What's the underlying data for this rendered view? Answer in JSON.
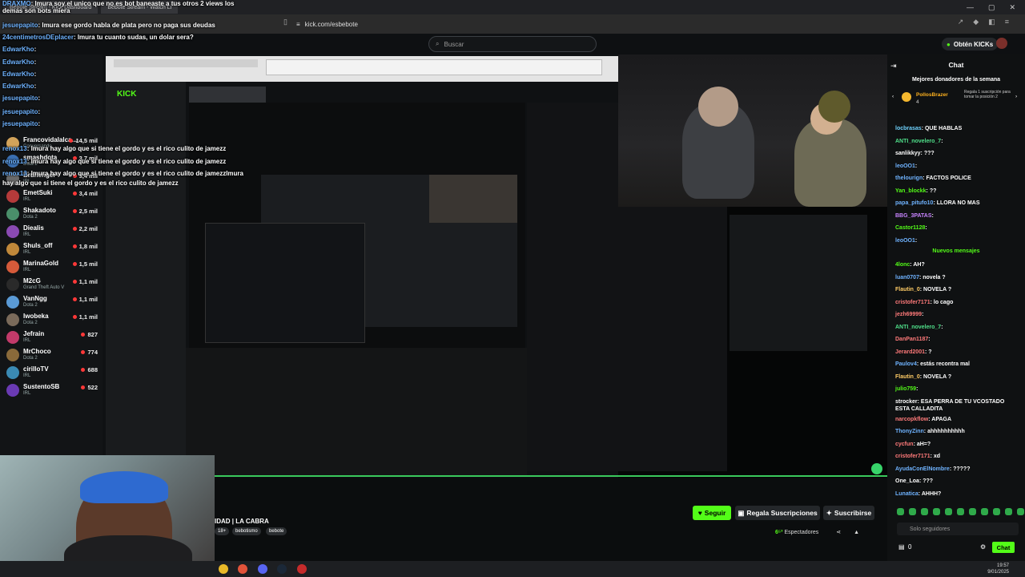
{
  "browser": {
    "tabs": [
      "Bebote Stream - Kick Dashboard",
      "Bebote Stream - Watch Li"
    ],
    "url": "kick.com/esbebote"
  },
  "header": {
    "search_placeholder": "Buscar",
    "kick_button": "Obtén KICKs"
  },
  "overlay_chat": [
    {
      "user": "DRAXMO",
      "text": "lmura soy el unico que no es bot baneaste a tus otros 2 views los demas son bots miera"
    },
    {
      "user": "jesuepapito",
      "text": "lmura ese gordo habla de plata pero no paga sus deudas"
    },
    {
      "user": "24centimetrosDEplacer",
      "text": "lmura tu cuanto sudas, un dolar sera?"
    },
    {
      "user": "EdwarKho",
      "text": ""
    },
    {
      "user": "EdwarKho",
      "text": ""
    },
    {
      "user": "EdwarKho",
      "text": ""
    },
    {
      "user": "EdwarKho",
      "text": ""
    },
    {
      "user": "jesuepapito",
      "text": ""
    },
    {
      "user": "jesuepapito",
      "text": ""
    },
    {
      "user": "jesuepapito",
      "text": ""
    },
    {
      "user": "renox13",
      "text": "lmura hay algo que si tiene el gordo y es el rico culito de jamezz"
    },
    {
      "user": "renox13",
      "text": "lmura hay algo que si tiene el gordo y es el rico culito de jamezz"
    },
    {
      "user": "renox13",
      "text": "lmura hay algo que si tiene el gordo y es el rico culito de jamezzlmura"
    },
    {
      "user": "",
      "text": "hay algo que si tiene el gordo y es el rico culito de jamezz"
    }
  ],
  "sidebar": {
    "channels": [
      {
        "name": "Francovidalalca...",
        "cat": "Conversando",
        "viewers": "14,5 mil"
      },
      {
        "name": "smashdota",
        "cat": "Dota 2",
        "viewers": "3,7 mil"
      },
      {
        "name": "Brunenger",
        "cat": "IRL",
        "viewers": "3,4 mil"
      },
      {
        "name": "EmetSuki",
        "cat": "IRL",
        "viewers": "3,4 mil"
      },
      {
        "name": "Shakadoto",
        "cat": "Dota 2",
        "viewers": "2,5 mil"
      },
      {
        "name": "Diealis",
        "cat": "IRL",
        "viewers": "2,2 mil"
      },
      {
        "name": "Shuls_off",
        "cat": "IRL",
        "viewers": "1,8 mil"
      },
      {
        "name": "MarinaGold",
        "cat": "IRL",
        "viewers": "1,5 mil"
      },
      {
        "name": "M2cG",
        "cat": "Grand Theft Auto V",
        "viewers": "1,1 mil"
      },
      {
        "name": "VanNgg",
        "cat": "Dota 2",
        "viewers": "1,1 mil"
      },
      {
        "name": "Iwobeka",
        "cat": "Dota 2",
        "viewers": "1,1 mil"
      },
      {
        "name": "Jefrain",
        "cat": "IRL",
        "viewers": "827"
      },
      {
        "name": "MrChoco",
        "cat": "Dota 2",
        "viewers": "774"
      },
      {
        "name": "cirilloTV",
        "cat": "IRL",
        "viewers": "688"
      },
      {
        "name": "SustentoSB",
        "cat": "IRL",
        "viewers": "522"
      }
    ]
  },
  "stream": {
    "title": "IDAD | LA CABRA",
    "tags": [
      "18+",
      "bebotismo",
      "bebote"
    ],
    "follow": "Seguir",
    "gift": "Regala Suscripciones",
    "subscribe": "Suscribirse",
    "viewers_count": "6⁵³",
    "viewers_label": "Espectadores"
  },
  "chat": {
    "title": "Chat",
    "donors_title": "Mejores donadores de la semana",
    "donor_name": "PollosBrazer",
    "donor_count": "4",
    "donor_cta": "Regala 1 suscripción para tomar la posición 2",
    "new_messages": "Nuevos mensajes",
    "input_placeholder": "Solo seguidores",
    "send": "Chat",
    "kicks": "0",
    "messages": [
      {
        "u": "locbrasas",
        "t": "QUE HABLAS",
        "c": "#6fd3ff"
      },
      {
        "u": "ANTI_novelero_7",
        "t": "",
        "c": "#4fe08a"
      },
      {
        "u": "sanlikkyy",
        "t": "???",
        "c": "#ffffff"
      },
      {
        "u": "leoOO1",
        "t": "",
        "c": "#6fb3ff"
      },
      {
        "u": "thelourign",
        "t": "FACTOS POLICE",
        "c": "#6fb3ff"
      },
      {
        "u": "Yan_blockk",
        "t": "??",
        "c": "#53fc18"
      },
      {
        "u": "papa_pitufo10",
        "t": "LLORA NO MAS",
        "c": "#6fb3ff"
      },
      {
        "u": "BBG_3PATAS",
        "t": "",
        "c": "#c884ff"
      },
      {
        "u": "Castor1128",
        "t": "",
        "c": "#53fc18"
      },
      {
        "u": "leoOO1",
        "t": "",
        "c": "#6fb3ff"
      },
      {
        "u": "4lonc",
        "t": "AH?",
        "c": "#53fc18"
      },
      {
        "u": "luan0707",
        "t": "novela ?",
        "c": "#6fb3ff"
      },
      {
        "u": "Flautin_0",
        "t": "NOVELA ?",
        "c": "#ffcc66"
      },
      {
        "u": "cristofer7171",
        "t": "lo cago",
        "c": "#ff7a7a"
      },
      {
        "u": "jezh69999",
        "t": "",
        "c": "#ff7a7a"
      },
      {
        "u": "ANTI_novelero_7",
        "t": "",
        "c": "#4fe08a"
      },
      {
        "u": "DanPan1187",
        "t": "",
        "c": "#ff7a7a"
      },
      {
        "u": "Jerard2001",
        "t": "?",
        "c": "#ff7a7a"
      },
      {
        "u": "Paulov4",
        "t": "estás recontra mal",
        "c": "#6fb3ff"
      },
      {
        "u": "Flautin_0",
        "t": "NOVELA ?",
        "c": "#ffcc66"
      },
      {
        "u": "julio759",
        "t": "",
        "c": "#53fc18"
      },
      {
        "u": "strocker",
        "t": "ESA PERRA DE TU VCOSTADO ESTA CALLADITA",
        "c": "#ffffff"
      },
      {
        "u": "narcopkflow",
        "t": "APAGA",
        "c": "#ff7a7a"
      },
      {
        "u": "ThonyZinn",
        "t": "ahhhhhhhhhh",
        "c": "#6fb3ff"
      },
      {
        "u": "cycfun",
        "t": "aH=?",
        "c": "#ff7a7a"
      },
      {
        "u": "cristofer7171",
        "t": "xd",
        "c": "#ff7a7a"
      },
      {
        "u": "AyudaConElNombre",
        "t": "?????",
        "c": "#6fb3ff"
      },
      {
        "u": "One_Loa",
        "t": "???",
        "c": "#ffffff"
      },
      {
        "u": "Lunatica",
        "t": "AHHH?",
        "c": "#6fb3ff"
      }
    ]
  },
  "clock": {
    "time": "19:57",
    "date": "9/01/2025"
  },
  "colors": {
    "accent": "#53fc18",
    "bg": "#0b0e0f",
    "panel": "#0f1112"
  }
}
